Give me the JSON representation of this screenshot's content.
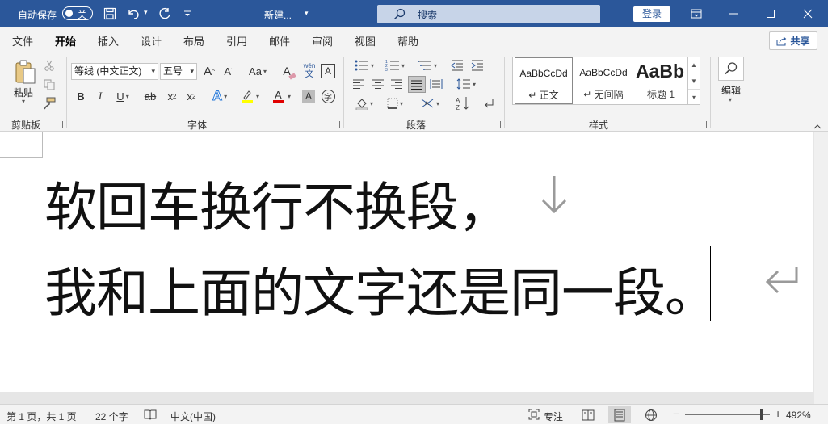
{
  "titlebar": {
    "autosave_label": "自动保存",
    "autosave_state": "关",
    "doc_name": "新建...",
    "search_placeholder": "搜索",
    "login_label": "登录",
    "accent": "#2b579a"
  },
  "tabs": [
    {
      "label": "文件"
    },
    {
      "label": "开始",
      "active": true
    },
    {
      "label": "插入"
    },
    {
      "label": "设计"
    },
    {
      "label": "布局"
    },
    {
      "label": "引用"
    },
    {
      "label": "邮件"
    },
    {
      "label": "审阅"
    },
    {
      "label": "视图"
    },
    {
      "label": "帮助"
    }
  ],
  "share_label": "共享",
  "ribbon": {
    "clipboard": {
      "paste_label": "粘贴",
      "group_label": "剪贴板"
    },
    "font": {
      "font_name": "等线 (中文正文)",
      "font_size": "五号",
      "group_label": "字体",
      "grow_label": "A",
      "shrink_label": "A",
      "case_label": "Aa",
      "bold": "B",
      "italic": "I",
      "underline": "U",
      "strike": "ab",
      "subscript": "x",
      "superscript": "x",
      "clear_label": "A",
      "border_label": "A",
      "pinyin_top": "wén",
      "pinyin_bottom": "文",
      "circle_char": "字"
    },
    "paragraph": {
      "group_label": "段落"
    },
    "styles": {
      "group_label": "样式",
      "items": [
        {
          "sample": "AaBbCcDd",
          "name": "↵ 正文"
        },
        {
          "sample": "AaBbCcDd",
          "name": "↵ 无间隔"
        },
        {
          "sample": "AaBb",
          "name": "标题 1"
        }
      ]
    },
    "editing": {
      "label": "编辑"
    }
  },
  "document": {
    "line1": "软回车换行不换段，",
    "line2": "我和上面的文字还是同一段。"
  },
  "status": {
    "page": "第 1 页，共 1 页",
    "words": "22 个字",
    "language": "中文(中国)",
    "focus": "专注",
    "zoom": "492%"
  }
}
